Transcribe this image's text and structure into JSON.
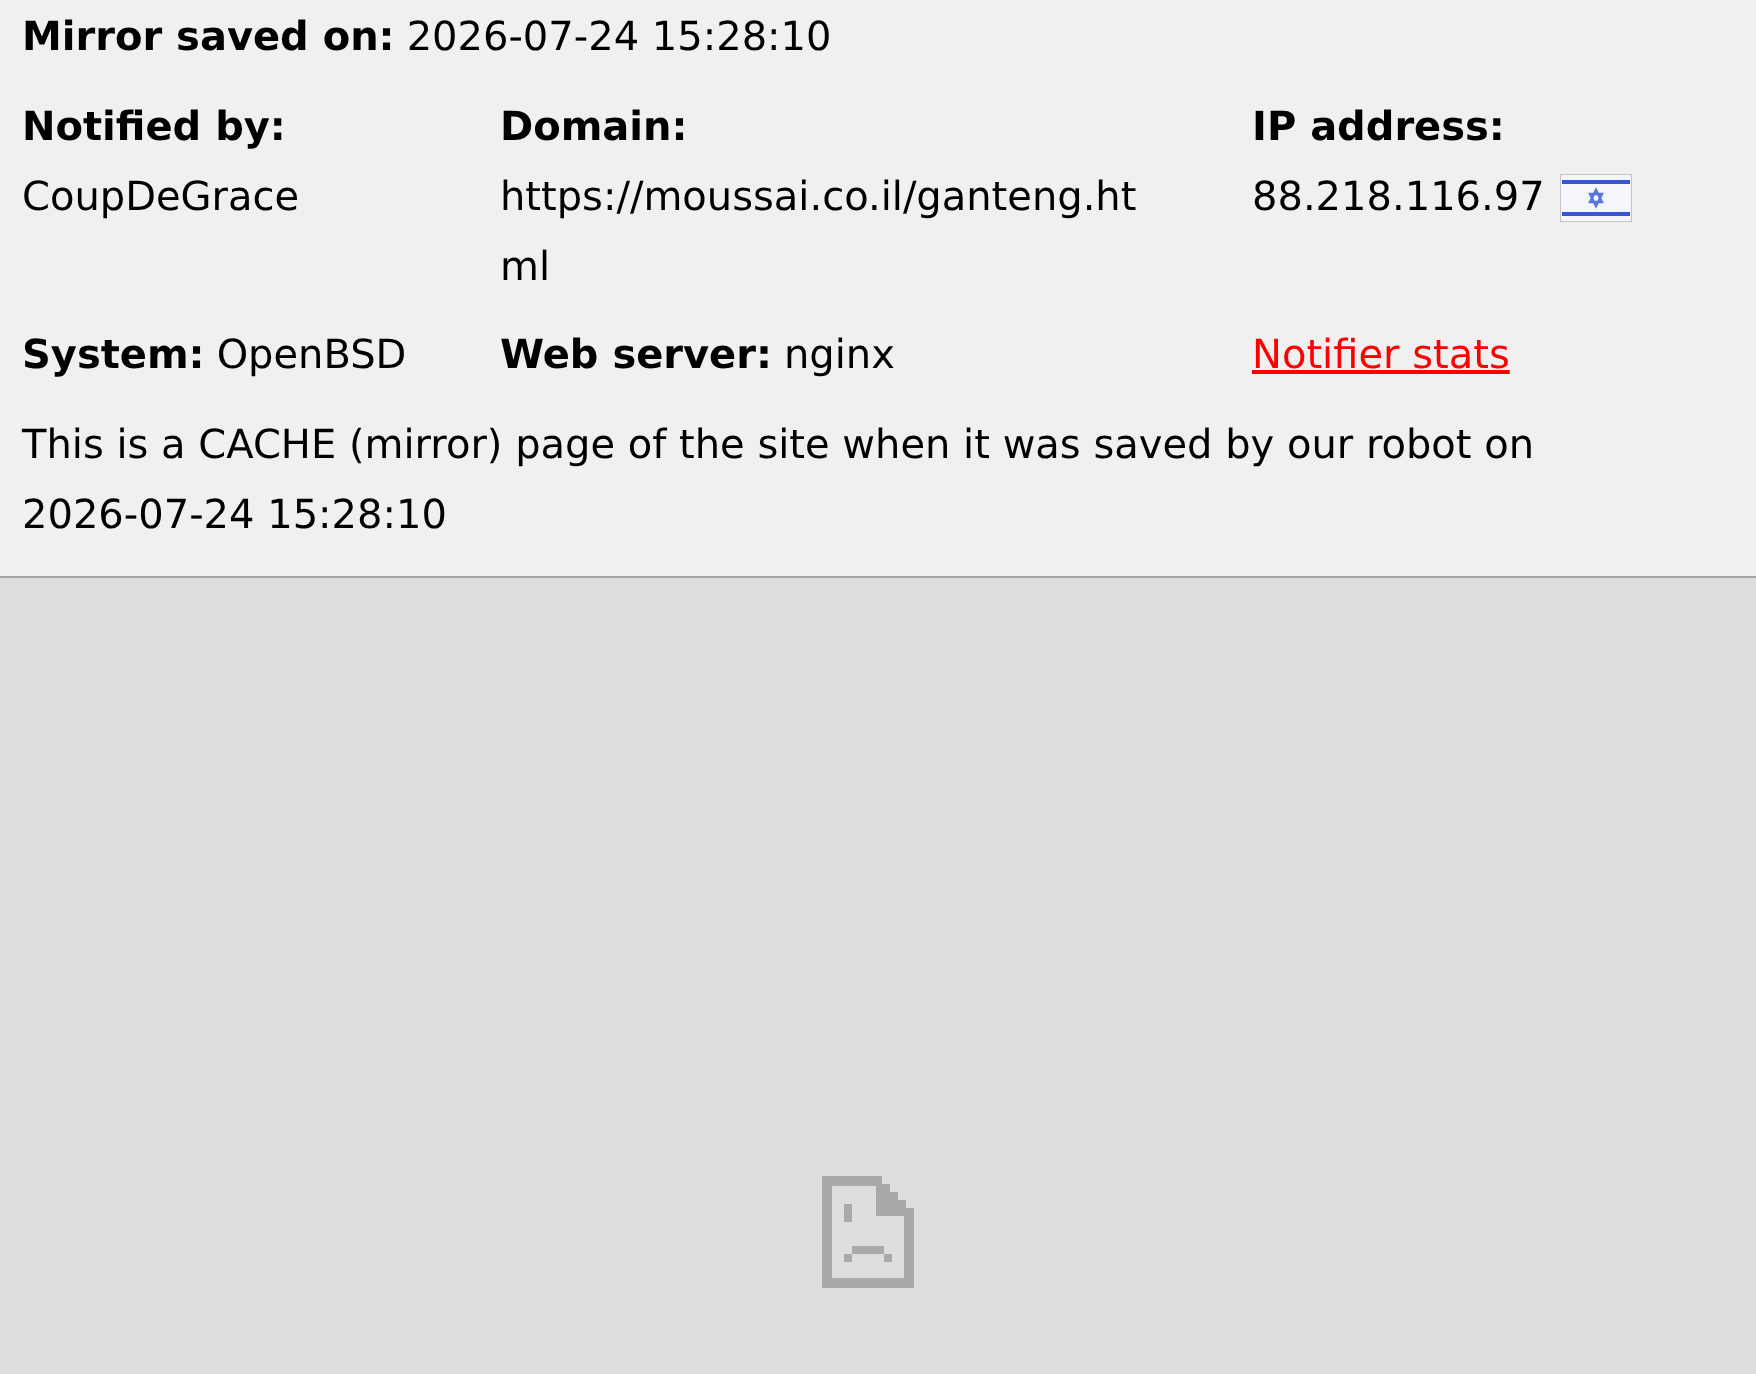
{
  "mirror_saved": {
    "label": "Mirror saved on:",
    "value": "2026-07-24 15:28:10"
  },
  "details": [
    {
      "label": "Notified by:",
      "value": "CoupDeGrace"
    },
    {
      "label": "Domain:",
      "value": "https://moussai.co.il/ganteng.html"
    },
    {
      "label": "IP address:",
      "value": "88.218.116.97"
    }
  ],
  "system": {
    "label": "System:",
    "value": "OpenBSD"
  },
  "web_server": {
    "label": "Web server:",
    "value": "nginx"
  },
  "notifier_stats_link": "Notifier stats",
  "notice": "This is a CACHE (mirror) page of the site when it was saved by our robot on 2026-07-24 15:28:10"
}
